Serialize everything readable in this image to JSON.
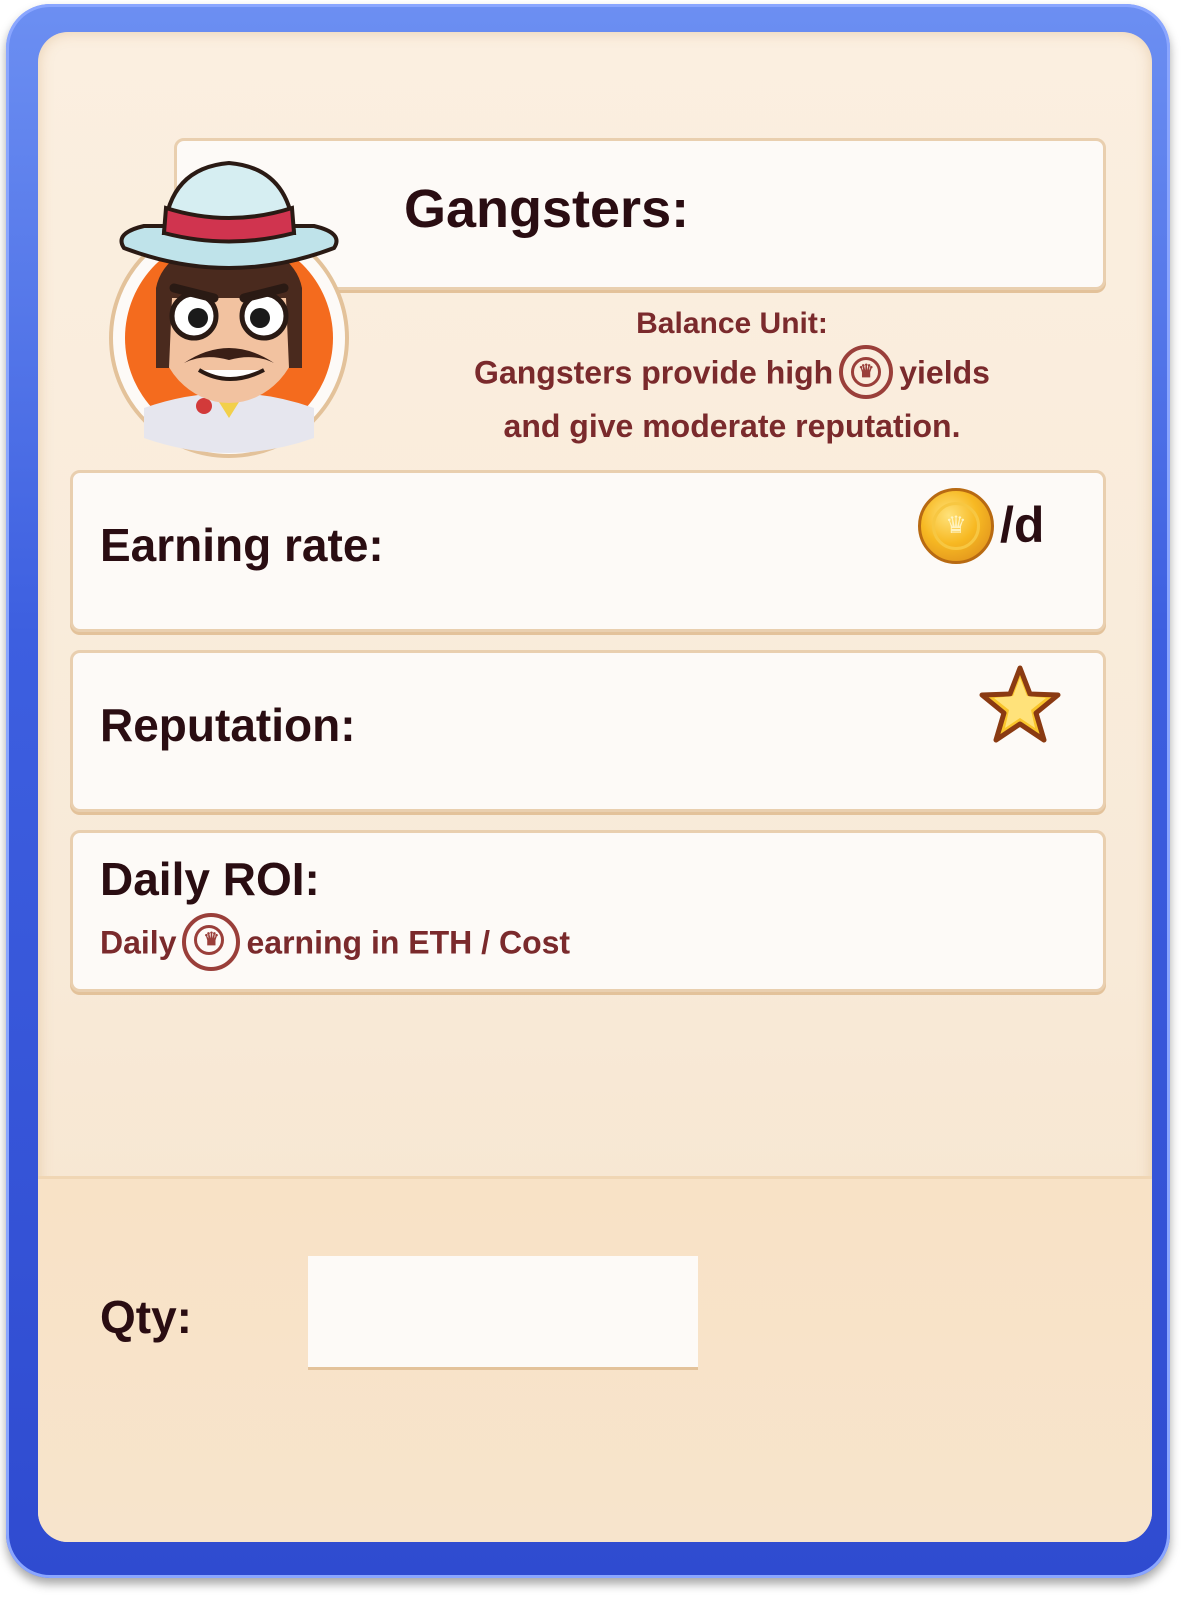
{
  "title": "Gangsters:",
  "description": {
    "heading": "Balance Unit:",
    "line1_before": "Gangsters provide high",
    "line1_after": "yields",
    "line2": "and give moderate reputation."
  },
  "stats": {
    "earning_rate": {
      "label": "Earning rate:",
      "unit": "/d",
      "icon": "gold-coin-icon"
    },
    "reputation": {
      "label": "Reputation:",
      "icon": "star-icon"
    },
    "daily_roi": {
      "label": "Daily ROI:",
      "sub_before": "Daily",
      "sub_after": "earning in ETH / Cost",
      "icon": "crown-coin-icon"
    }
  },
  "qty": {
    "label": "Qty:",
    "value": ""
  },
  "colors": {
    "frame": "#3d5fe0",
    "card": "#fbefe0",
    "text_dark": "#2a0d12",
    "text_accent": "#7a2a2c"
  }
}
